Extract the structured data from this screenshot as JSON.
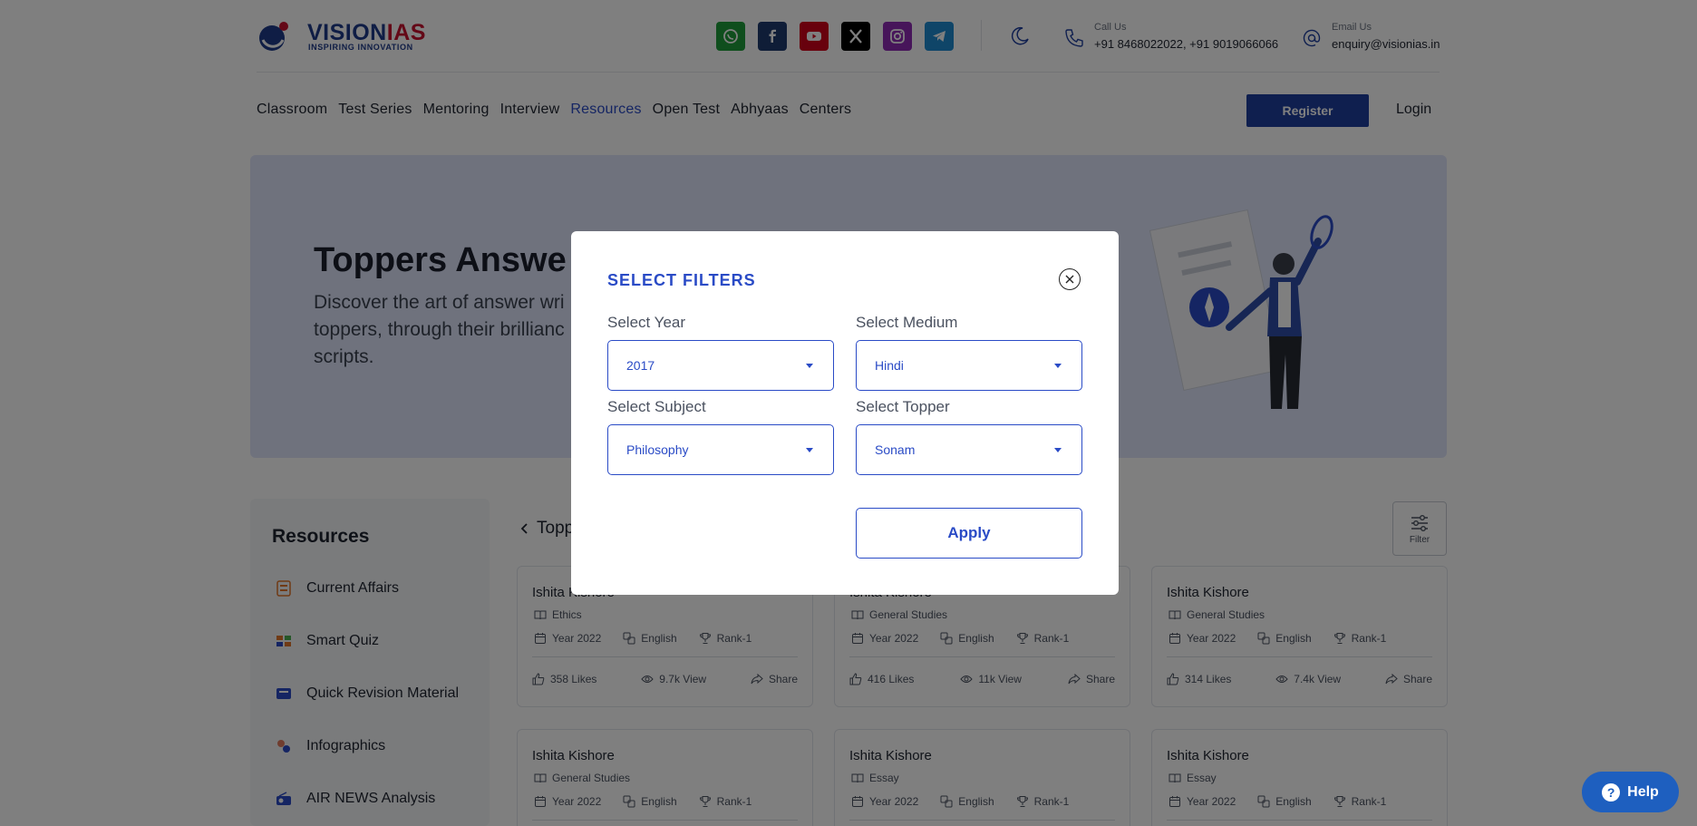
{
  "header": {
    "logo_primary": "VISION",
    "logo_accent": "IAS",
    "logo_tagline": "INSPIRING INNOVATION",
    "call_label": "Call Us",
    "call_value": "+91 8468022022, +91 9019066066",
    "email_label": "Email Us",
    "email_value": "enquiry@visionias.in",
    "socials": [
      {
        "icon": "whatsapp-icon",
        "color": "#1f9d3a"
      },
      {
        "icon": "facebook-icon",
        "color": "#1e3a6e"
      },
      {
        "icon": "youtube-icon",
        "color": "#d0021b"
      },
      {
        "icon": "x-icon",
        "color": "#000000"
      },
      {
        "icon": "instagram-icon",
        "color": "#8e2bb5"
      },
      {
        "icon": "telegram-icon",
        "color": "#1f8ad1"
      }
    ]
  },
  "nav": {
    "items": [
      "Classroom",
      "Test Series",
      "Mentoring",
      "Interview",
      "Resources",
      "Open Test",
      "Abhyaas",
      "Centers"
    ],
    "active": "Resources",
    "register_label": "Register",
    "login_label": "Login"
  },
  "hero": {
    "title": "Toppers Answe",
    "desc_line1": "Discover the art of answer wri",
    "desc_line2": "toppers, through their brillianc",
    "desc_line3": "scripts."
  },
  "sidebar": {
    "title": "Resources",
    "items": [
      "Current Affairs",
      "Smart Quiz",
      "Quick Revision Material",
      "Infographics",
      "AIR NEWS Analysis"
    ]
  },
  "content": {
    "back_label": "Topp",
    "filter_label": "Filter"
  },
  "cards": [
    {
      "name": "Ishita Kishore",
      "subject": "Ethics",
      "year": "Year 2022",
      "medium": "English",
      "rank": "Rank-1",
      "likes": "358 Likes",
      "views": "9.7k View",
      "share": "Share"
    },
    {
      "name": "Ishita Kishore",
      "subject": "General Studies",
      "year": "Year 2022",
      "medium": "English",
      "rank": "Rank-1",
      "likes": "416 Likes",
      "views": "11k View",
      "share": "Share"
    },
    {
      "name": "Ishita Kishore",
      "subject": "General Studies",
      "year": "Year 2022",
      "medium": "English",
      "rank": "Rank-1",
      "likes": "314 Likes",
      "views": "7.4k View",
      "share": "Share"
    },
    {
      "name": "Ishita Kishore",
      "subject": "General Studies",
      "year": "Year 2022",
      "medium": "English",
      "rank": "Rank-1"
    },
    {
      "name": "Ishita Kishore",
      "subject": "Essay",
      "year": "Year 2022",
      "medium": "English",
      "rank": "Rank-1"
    },
    {
      "name": "Ishita Kishore",
      "subject": "Essay",
      "year": "Year 2022",
      "medium": "English",
      "rank": "Rank-1"
    }
  ],
  "modal": {
    "title": "SELECT FILTERS",
    "year_label": "Select Year",
    "year_value": "2017",
    "medium_label": "Select Medium",
    "medium_value": "Hindi",
    "subject_label": "Select Subject",
    "subject_value": "Philosophy",
    "topper_label": "Select Topper",
    "topper_value": "Sonam",
    "apply_label": "Apply"
  },
  "help": {
    "label": "Help"
  },
  "colors": {
    "accent": "#2a4bc6",
    "brand_blue": "#1e3e9e",
    "brand_red": "#c8102e",
    "hero_bg": "#dfe5fb"
  }
}
